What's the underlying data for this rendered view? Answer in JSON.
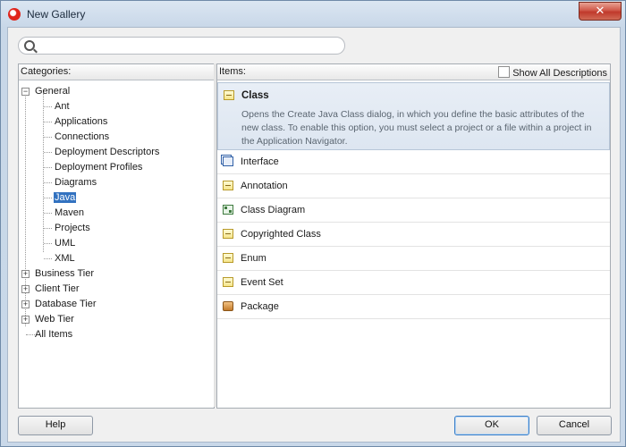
{
  "window": {
    "title": "New Gallery",
    "close_label": "✕"
  },
  "search": {
    "placeholder": "",
    "value": ""
  },
  "categories": {
    "header": "Categories:",
    "general": "General",
    "children": [
      "Ant",
      "Applications",
      "Connections",
      "Deployment Descriptors",
      "Deployment Profiles",
      "Diagrams",
      "Java",
      "Maven",
      "Projects",
      "UML",
      "XML"
    ],
    "selected": "Java",
    "top_level": [
      "Business Tier",
      "Client Tier",
      "Database Tier",
      "Web Tier"
    ],
    "all_items": "All Items"
  },
  "items": {
    "header": "Items:",
    "show_all_label": "Show All Descriptions",
    "show_all_checked": false,
    "selected": {
      "label": "Class",
      "icon": "class-icon",
      "description": "Opens the Create Java Class dialog, in which you define the basic attributes of the new class. To enable this option, you must select a project or a file within a project in the Application Navigator."
    },
    "list": [
      {
        "label": "Interface",
        "icon": "interface-icon"
      },
      {
        "label": "Annotation",
        "icon": "class-icon"
      },
      {
        "label": "Class Diagram",
        "icon": "class-diagram-icon"
      },
      {
        "label": "Copyrighted Class",
        "icon": "class-icon"
      },
      {
        "label": "Enum",
        "icon": "class-icon"
      },
      {
        "label": "Event Set",
        "icon": "class-icon"
      },
      {
        "label": "Package",
        "icon": "package-icon"
      }
    ]
  },
  "buttons": {
    "help": "Help",
    "ok": "OK",
    "cancel": "Cancel"
  }
}
